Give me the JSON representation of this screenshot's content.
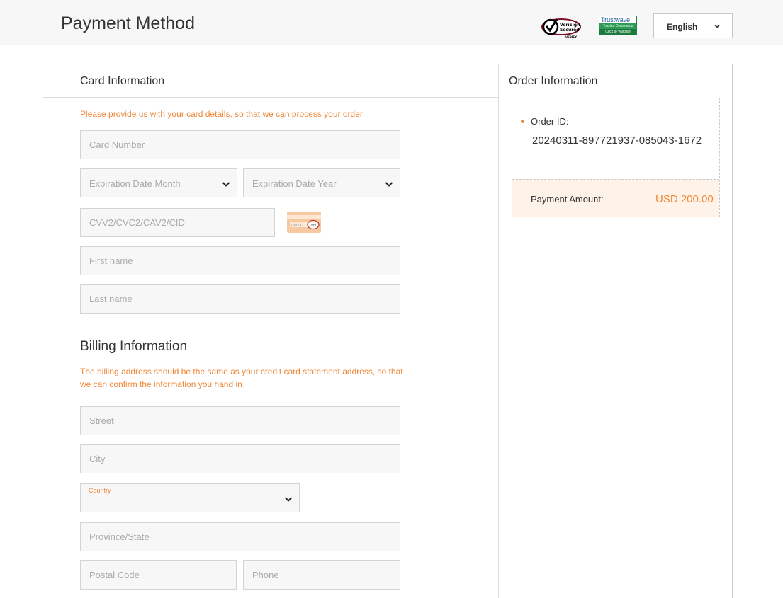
{
  "header": {
    "title": "Payment Method",
    "verisign_badge": "VeriSign Secured",
    "trustwave_badge": {
      "brand": "Trustwave",
      "line1": "Trusted Commerce",
      "line2": "Click to Validate"
    },
    "language": "English"
  },
  "card_info": {
    "title": "Card Information",
    "hint": "Please provide us with your card details, so that we can process your order",
    "card_number_placeholder": "Card Number",
    "exp_month_placeholder": "Expiration Date Month",
    "exp_year_placeholder": "Expiration Date Year",
    "cvv_placeholder": "CVV2/CVC2/CAV2/CID",
    "first_name_placeholder": "First name",
    "last_name_placeholder": "Last name"
  },
  "billing_info": {
    "title": "Billing Information",
    "hint_line1": "The billing address should be the same as your credit card statement address, so that",
    "hint_line2": "we can confirm the information you hand in",
    "street_placeholder": "Street",
    "city_placeholder": "City",
    "country_label": "Country",
    "province_placeholder": "Province/State",
    "postal_placeholder": "Postal Code",
    "phone_placeholder": "Phone"
  },
  "order_info": {
    "title": "Order Information",
    "order_id_label": "Order ID:",
    "order_id_value": "20240311-897721937-085043-1672",
    "amount_label": "Payment Amount:",
    "amount_value": "USD 200.00"
  },
  "colors": {
    "accent": "#f0883a",
    "amount_bg": "#fff2e8",
    "field_bg": "#f7f7f7"
  },
  "icons": [
    "verisign-check-icon",
    "chevron-down-icon",
    "cvv-card-icon"
  ]
}
